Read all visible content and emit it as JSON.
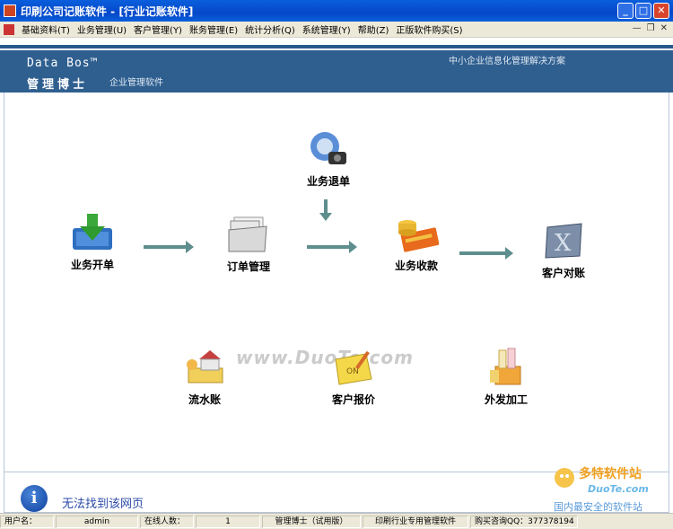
{
  "window": {
    "title": "印刷公司记账软件 - [行业记账软件]"
  },
  "menu": {
    "items": [
      "基础资料(T)",
      "业务管理(U)",
      "客户管理(Y)",
      "账务管理(E)",
      "统计分析(Q)",
      "系统管理(Y)",
      "帮助(Z)",
      "正版软件购买(S)"
    ]
  },
  "header": {
    "brand_en": "Data Bos™",
    "brand_cn": "管理博士",
    "brand_sub": "企业管理软件",
    "tagline": "中小企业信息化管理解决方案"
  },
  "flow": {
    "open_order": "业务开单",
    "order_manage": "订单管理",
    "return_order": "业务退单",
    "collect": "业务收款",
    "reconcile": "客户对账",
    "journal": "流水账",
    "quote": "客户报价",
    "outsourcing": "外发加工"
  },
  "watermark": "www.DuoTe.com",
  "error_panel": {
    "text": "无法找到该网页"
  },
  "status": {
    "user_label": "用户名：",
    "user_value": "admin",
    "online_label": "在线人数：",
    "online_value": "1",
    "edition": "管理博士（试用版）",
    "product": "印刷行业专用管理软件",
    "contact": "购买咨询QQ：377378194"
  },
  "logo_overlay": {
    "cn": "多特软件站",
    "en": "DuoTe.com",
    "slogan": "国内最安全的软件站"
  },
  "colors": {
    "header_band": "#2f5f8f",
    "arrow": "#5e8e8e",
    "titlebar": "#0a5fdc"
  }
}
